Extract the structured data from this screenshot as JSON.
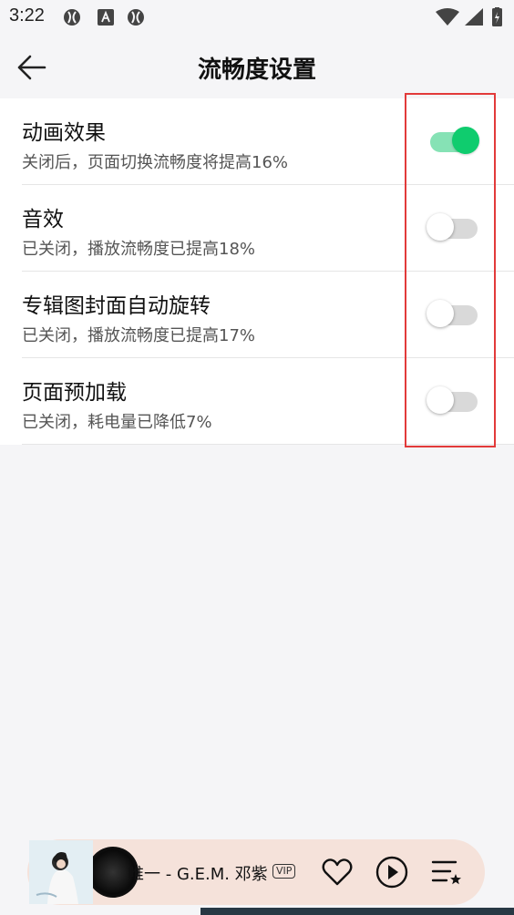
{
  "status_bar": {
    "time": "3:22"
  },
  "header": {
    "title": "流畅度设置"
  },
  "settings": [
    {
      "title": "动画效果",
      "desc": "关闭后，页面切换流畅度将提高16%",
      "enabled": true
    },
    {
      "title": "音效",
      "desc": "已关闭，播放流畅度已提高18%",
      "enabled": false
    },
    {
      "title": "专辑图封面自动旋转",
      "desc": "已关闭，播放流畅度已提高17%",
      "enabled": false
    },
    {
      "title": "页面预加载",
      "desc": "已关闭，耗电量已降低7%",
      "enabled": false
    }
  ],
  "player": {
    "song": "唯一 - G.E.M. 邓紫",
    "badge": "VIP"
  },
  "colors": {
    "accent": "#0fcc6e",
    "accent_track": "#86e2b5",
    "highlight": "#e23a3a",
    "player_bg": "#f5e2da"
  },
  "icons": [
    "back-arrow-icon",
    "heart-icon",
    "play-icon",
    "playlist-icon",
    "wifi-icon",
    "signal-icon",
    "battery-icon"
  ]
}
